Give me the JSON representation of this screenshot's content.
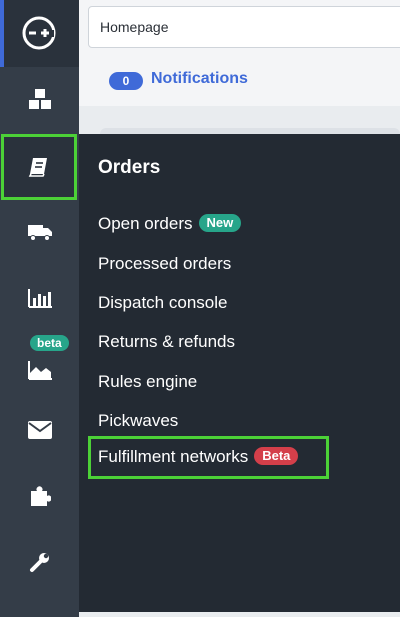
{
  "header": {
    "breadcrumb": "Homepage"
  },
  "notifications": {
    "count": "0",
    "label": "Notifications"
  },
  "sidebar": {
    "items": [
      {
        "icon": "logo-icon"
      },
      {
        "icon": "cubes-icon"
      },
      {
        "icon": "orders-book-icon",
        "selected": true
      },
      {
        "icon": "truck-icon"
      },
      {
        "icon": "bar-chart-icon"
      },
      {
        "icon": "area-chart-icon",
        "badge": "beta"
      },
      {
        "icon": "envelope-icon"
      },
      {
        "icon": "puzzle-icon"
      },
      {
        "icon": "wrench-icon"
      }
    ]
  },
  "flyout": {
    "title": "Orders",
    "items": [
      {
        "label": "Open orders",
        "tag": "New"
      },
      {
        "label": "Processed orders"
      },
      {
        "label": "Dispatch console"
      },
      {
        "label": "Returns & refunds"
      },
      {
        "label": "Rules engine"
      },
      {
        "label": "Pickwaves"
      },
      {
        "label": "Fulfillment networks",
        "tag": "Beta",
        "highlighted": true
      }
    ]
  },
  "colors": {
    "rail": "#343d48",
    "flyout": "#232a33",
    "accent": "#3f6ad8",
    "highlight": "#4cd137",
    "new_tag": "#27a58a",
    "beta_tag": "#d43f4a"
  }
}
